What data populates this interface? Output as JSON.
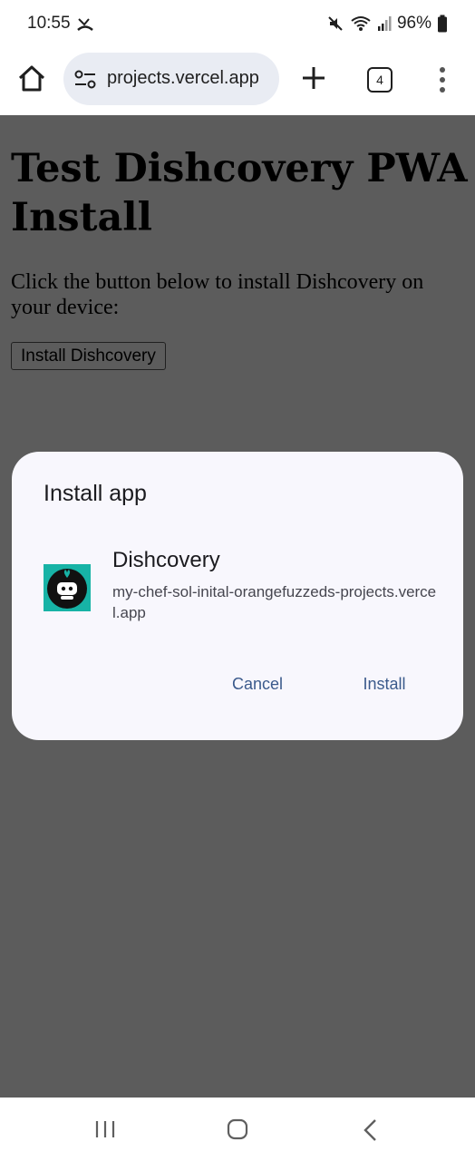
{
  "status_bar": {
    "time": "10:55",
    "battery": "96%"
  },
  "toolbar": {
    "url": "projects.vercel.app",
    "tab_count": "4"
  },
  "page": {
    "title": "Test Dishcovery PWA Install",
    "description": "Click the button below to install Dishcovery on your device:",
    "install_button_label": "Install Dishcovery"
  },
  "dialog": {
    "title": "Install app",
    "app_name": "Dishcovery",
    "app_url": "my-chef-sol-inital-orangefuzzeds-projects.vercel.app",
    "cancel_label": "Cancel",
    "install_label": "Install",
    "icon_color": "#17b3a6"
  },
  "colors": {
    "scrim": "#5c5c5c",
    "dialog_bg": "#f8f7fd",
    "accent": "#3b5a8c"
  }
}
